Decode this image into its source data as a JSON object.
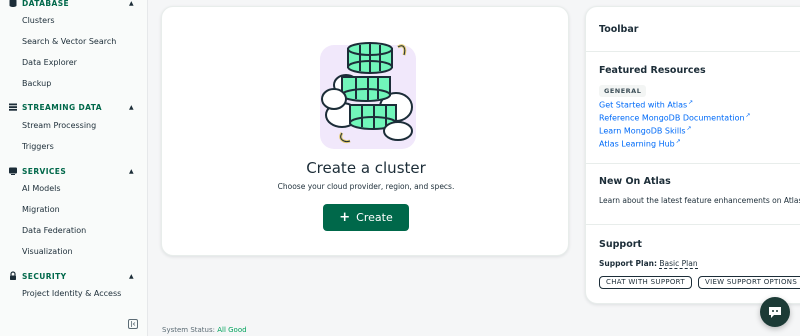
{
  "sidebar": {
    "sections": [
      {
        "label": "DATABASE",
        "icon": "database-icon"
      },
      {
        "label": "STREAMING DATA",
        "icon": "stream-icon"
      },
      {
        "label": "SERVICES",
        "icon": "services-icon"
      },
      {
        "label": "SECURITY",
        "icon": "lock-icon"
      }
    ],
    "items": {
      "clusters": "Clusters",
      "search": "Search & Vector Search",
      "data_explorer": "Data Explorer",
      "backup": "Backup",
      "stream_processing": "Stream Processing",
      "triggers": "Triggers",
      "ai_models": "AI Models",
      "migration": "Migration",
      "data_federation": "Data Federation",
      "visualization": "Visualization",
      "project_identity": "Project Identity & Access"
    }
  },
  "main": {
    "title": "Create a cluster",
    "subtitle": "Choose your cloud provider, region, and specs.",
    "create_button": "Create"
  },
  "status": {
    "label": "System Status:",
    "value": "All Good"
  },
  "right_panel": {
    "toolbar_title": "Toolbar",
    "featured_title": "Featured Resources",
    "badge": "GENERAL",
    "links": [
      "Get Started with Atlas",
      "Reference MongoDB Documentation",
      "Learn MongoDB Skills",
      "Atlas Learning Hub"
    ],
    "new_title": "New On Atlas",
    "new_text": "Learn about the latest feature enhancements on Atlas.",
    "support_title": "Support",
    "support_plan_label": "Support Plan:",
    "support_plan_value": "Basic Plan",
    "chat_button": "CHAT WITH SUPPORT",
    "view_button": "VIEW SUPPORT OPTIONS"
  },
  "colors": {
    "brand_green": "#00684a",
    "link_blue": "#016bf8",
    "status_green": "#00a35c",
    "illustration_green": "#71f6ba",
    "illustration_bg": "#f1e8fb"
  }
}
